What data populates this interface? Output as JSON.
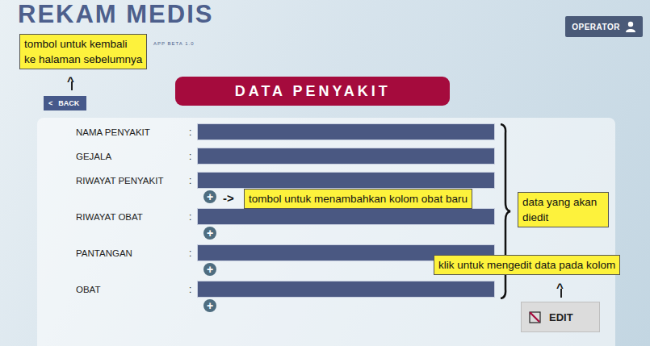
{
  "app": {
    "title": "REKAM MEDIS",
    "version": "APP BETA 1.0"
  },
  "user_button": {
    "label": "OPERATOR"
  },
  "back_button": {
    "icon": "<",
    "label": "BACK"
  },
  "page_title": "DATA PENYAKIT",
  "separator": ":",
  "add_icon": "+",
  "fields": [
    {
      "label": "NAMA PENYAKIT",
      "has_add_button": false
    },
    {
      "label": "GEJALA",
      "has_add_button": false
    },
    {
      "label": "RIWAYAT PENYAKIT",
      "has_add_button": true
    },
    {
      "label": "RIWAYAT OBAT",
      "has_add_button": true
    },
    {
      "label": "PANTANGAN",
      "has_add_button": true
    },
    {
      "label": "OBAT",
      "has_add_button": true
    }
  ],
  "edit_button": {
    "label": "EDIT"
  },
  "annotations": {
    "back": {
      "lines": [
        "tombol untuk kembali",
        "ke halaman sebelumnya"
      ],
      "arrow": "^"
    },
    "add": {
      "text": "tombol untuk menambahkan kolom obat baru",
      "arrow": "->"
    },
    "data": {
      "lines": [
        "data yang akan",
        "diedit"
      ]
    },
    "edit": {
      "text": "klik untuk mengedit data pada kolom",
      "arrow": "^"
    }
  }
}
